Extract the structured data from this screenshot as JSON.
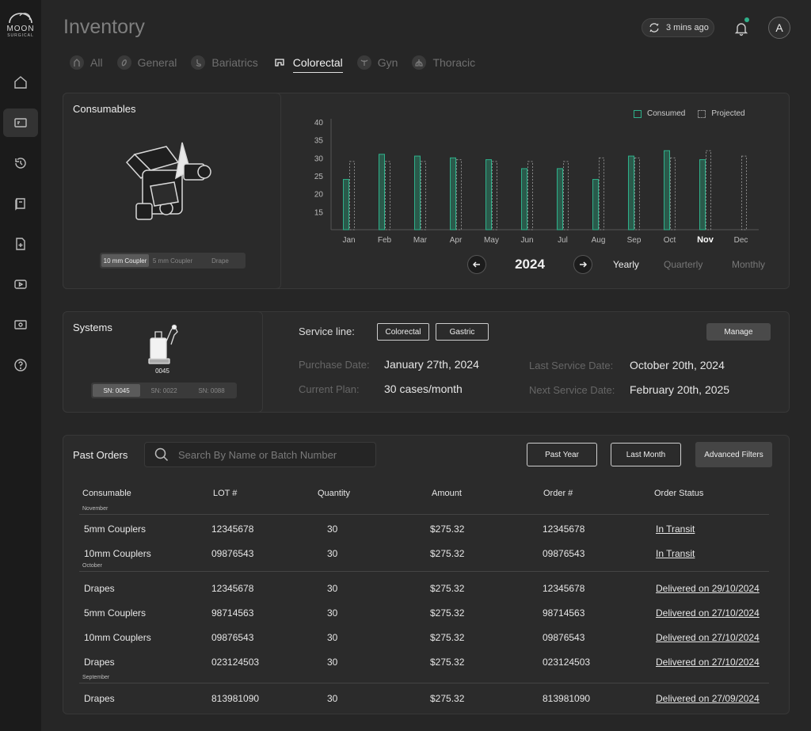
{
  "brand": {
    "line1": "MOON",
    "line2": "SURGICAL"
  },
  "page": {
    "title": "Inventory"
  },
  "header": {
    "sync_text": "3 mins ago",
    "avatar_initial": "A"
  },
  "tabs": [
    {
      "label": "All",
      "active": false
    },
    {
      "label": "General",
      "active": false
    },
    {
      "label": "Bariatrics",
      "active": false
    },
    {
      "label": "Colorectal",
      "active": true
    },
    {
      "label": "Gyn",
      "active": false
    },
    {
      "label": "Thoracic",
      "active": false
    }
  ],
  "consumables": {
    "title": "Consumables",
    "options": [
      "10 mm Coupler",
      "5 mm Coupler",
      "Drape"
    ],
    "selected": "10 mm Coupler"
  },
  "chart_data": {
    "type": "bar",
    "categories": [
      "Jan",
      "Feb",
      "Mar",
      "Apr",
      "May",
      "Jun",
      "Jul",
      "Aug",
      "Sep",
      "Oct",
      "Nov",
      "Dec"
    ],
    "highlight": "Nov",
    "series": [
      {
        "name": "Consumed",
        "values": [
          24,
          31,
          30.5,
          30,
          29.5,
          27,
          27,
          24,
          30.5,
          32,
          29.5,
          null
        ],
        "color": "#2fb08a"
      },
      {
        "name": "Projected",
        "values": [
          29,
          29,
          29,
          29.5,
          29,
          29,
          29,
          30,
          30,
          30,
          32,
          30.5
        ],
        "color": "#8a8a8a"
      }
    ],
    "yticks": [
      15,
      20,
      25,
      30,
      35,
      40
    ],
    "ylim": [
      10,
      40
    ],
    "legend": "top-right"
  },
  "period": {
    "year": "2024",
    "options": [
      "Yearly",
      "Quarterly",
      "Monthly"
    ],
    "selected": "Yearly"
  },
  "systems": {
    "title": "Systems",
    "robot_label": "0045",
    "options": [
      "SN: 0045",
      "SN: 0022",
      "SN: 0088"
    ],
    "selected": "SN: 0045",
    "service_line_label": "Service line:",
    "service_lines": [
      "Colorectal",
      "Gastric"
    ],
    "manage_label": "Manage",
    "purchase_date_label": "Purchase Date:",
    "purchase_date": "January 27th, 2024",
    "current_plan_label": "Current Plan:",
    "current_plan": "30 cases/month",
    "last_service_label": "Last Service Date:",
    "last_service": "October 20th, 2024",
    "next_service_label": "Next Service Date:",
    "next_service": "February 20th, 2025"
  },
  "orders": {
    "title": "Past Orders",
    "search_placeholder": "Search By Name or Batch Number",
    "filters": [
      "Past Year",
      "Last Month",
      "Advanced Filters"
    ],
    "columns": [
      "Consumable",
      "LOT #",
      "Quantity",
      "Amount",
      "Order #",
      "Order Status"
    ],
    "groups": [
      {
        "label": "November",
        "rows": [
          {
            "name": "5mm Couplers",
            "lot": "12345678",
            "qty": "30",
            "amount": "$275.32",
            "order": "12345678",
            "status": "In Transit"
          },
          {
            "name": "10mm Couplers",
            "lot": "09876543",
            "qty": "30",
            "amount": "$275.32",
            "order": "09876543",
            "status": "In Transit"
          }
        ]
      },
      {
        "label": "October",
        "rows": [
          {
            "name": "Drapes",
            "lot": "12345678",
            "qty": "30",
            "amount": "$275.32",
            "order": "12345678",
            "status": "Delivered on 29/10/2024"
          },
          {
            "name": "5mm Couplers",
            "lot": "98714563",
            "qty": "30",
            "amount": "$275.32",
            "order": "98714563",
            "status": "Delivered on 27/10/2024"
          },
          {
            "name": "10mm Couplers",
            "lot": "09876543",
            "qty": "30",
            "amount": "$275.32",
            "order": "09876543",
            "status": "Delivered on 27/10/2024"
          },
          {
            "name": "Drapes",
            "lot": "023124503",
            "qty": "30",
            "amount": "$275.32",
            "order": "023124503",
            "status": "Delivered on 27/10/2024"
          }
        ]
      },
      {
        "label": "September",
        "rows": [
          {
            "name": "Drapes",
            "lot": "813981090",
            "qty": "30",
            "amount": "$275.32",
            "order": "813981090",
            "status": "Delivered on 27/09/2024"
          }
        ]
      }
    ]
  }
}
